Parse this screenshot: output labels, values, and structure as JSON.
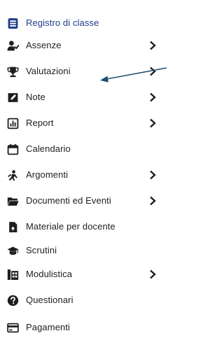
{
  "menu": {
    "accent_color": "#1f3d8c",
    "annotation_arrow_color": "#1a4f72",
    "items": [
      {
        "label": "Registro di classe",
        "icon": "book-icon",
        "has_submenu": false,
        "active": true
      },
      {
        "label": "Assenze",
        "icon": "user-check-icon",
        "has_submenu": true,
        "active": false
      },
      {
        "label": "Valutazioni",
        "icon": "trophy-icon",
        "has_submenu": true,
        "active": false
      },
      {
        "label": "Note",
        "icon": "note-icon",
        "has_submenu": true,
        "active": false
      },
      {
        "label": "Report",
        "icon": "chart-icon",
        "has_submenu": true,
        "active": false
      },
      {
        "label": "Calendario",
        "icon": "calendar-icon",
        "has_submenu": false,
        "active": false
      },
      {
        "label": "Argomenti",
        "icon": "people-icon",
        "has_submenu": true,
        "active": false
      },
      {
        "label": "Documenti ed Eventi",
        "icon": "folder-icon",
        "has_submenu": true,
        "active": false
      },
      {
        "label": "Materiale per docente",
        "icon": "file-upload-icon",
        "has_submenu": false,
        "active": false
      },
      {
        "label": "Scrutini",
        "icon": "graduation-cap-icon",
        "has_submenu": false,
        "active": false
      },
      {
        "label": "Modulistica",
        "icon": "forms-icon",
        "has_submenu": true,
        "active": false
      },
      {
        "label": "Questionari",
        "icon": "question-icon",
        "has_submenu": false,
        "active": false
      },
      {
        "label": "Pagamenti",
        "icon": "credit-card-icon",
        "has_submenu": false,
        "active": false
      }
    ]
  }
}
